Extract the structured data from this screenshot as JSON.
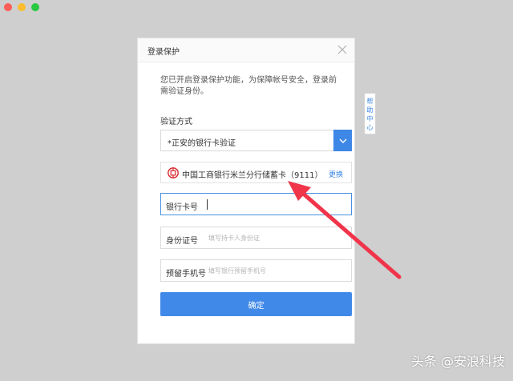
{
  "window": {
    "traffic_lights": [
      "close",
      "minimize",
      "zoom"
    ]
  },
  "dialog": {
    "title": "登录保护",
    "notice": "您已开启登录保护功能，为保障帐号安全，登录前需验证身份。",
    "method_label": "验证方式",
    "method_value": "*正安的银行卡验证",
    "bank_card": {
      "name": "中国工商银行米兰分行储蓄卡（9111）",
      "change_label": "更换",
      "logo_icon": "icbc-logo-icon"
    },
    "fields": {
      "card_number": {
        "label": "银行卡号",
        "value": "",
        "placeholder": ""
      },
      "id_number": {
        "label": "身份证号",
        "value": "",
        "placeholder": "填写持卡人身份证"
      },
      "phone": {
        "label": "预留手机号",
        "value": "",
        "placeholder": "填写银行预留手机号"
      }
    },
    "confirm_label": "确定"
  },
  "help_tab": {
    "label": "帮助中心"
  },
  "watermark": "头条 @安浪科技",
  "colors": {
    "accent": "#4189e8",
    "arrow": "#f0344a"
  }
}
